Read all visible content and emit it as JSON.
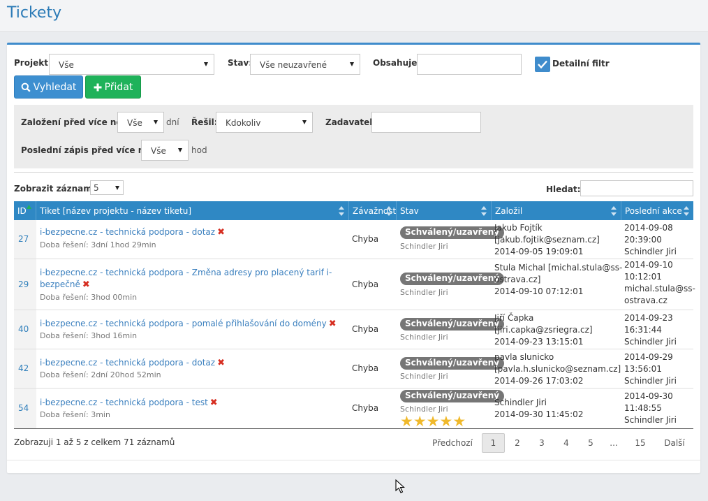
{
  "page": {
    "title": "Tickety"
  },
  "filters": {
    "project_label": "Projekt:",
    "project_value": "Vše",
    "status_label": "Stav:",
    "status_value": "Vše neuzavřené",
    "contains_label": "Obsahuje:",
    "contains_value": "",
    "detail_filter_label": "Detailní filtr",
    "detail_filter_checked": true,
    "search_button": "Vyhledat",
    "add_button": "Přidat"
  },
  "detail": {
    "created_label": "Založení před více než:",
    "created_value": "Vše",
    "created_unit": "dní",
    "solver_label": "Řešil:",
    "solver_value": "Kdokoliv",
    "requester_label": "Zadavatel:",
    "requester_value": "",
    "last_entry_label": "Poslední zápis před více než:",
    "last_entry_value": "Vše",
    "last_entry_unit": "hod"
  },
  "table_controls": {
    "show_label": "Zobrazit záznamů",
    "show_value": "5",
    "search_label": "Hledat:",
    "search_value": ""
  },
  "columns": {
    "id": "ID",
    "ticket": "Tiket [název projektu - název tiketu]",
    "severity": "Závažnost",
    "status": "Stav",
    "created_by": "Založil",
    "last_action": "Poslední akce"
  },
  "rows": [
    {
      "id": "27",
      "title": "i-bezpecne.cz - technická podpora - dotaz",
      "duration": "Doba řešení: 3dní 1hod 29min",
      "severity": "Chyba",
      "status": "Schválený/uzavřený",
      "solver": "Schindler Jiri",
      "created_by_1": "Jakub Fojtík",
      "created_by_2": "[jakub.fojtik@seznam.cz]",
      "created_at": "2014-09-05 19:09:01",
      "last_1": "2014-09-08",
      "last_2": "20:39:00",
      "last_3": "Schindler Jiri",
      "last_4": ""
    },
    {
      "id": "29",
      "title_1": "i-bezpecne.cz - technická podpora - Změna adresy pro placený tarif i-",
      "title_2": "bezpečně",
      "duration": "Doba řešení: 3hod 00min",
      "severity": "Chyba",
      "status": "Schválený/uzavřený",
      "solver": "Schindler Jiri",
      "created_by_1": "Stula Michal [michal.stula@ss-",
      "created_by_2": "ostrava.cz]",
      "created_at": "2014-09-10 07:12:01",
      "last_1": "2014-09-10",
      "last_2": "10:12:01",
      "last_3": "michal.stula@ss-",
      "last_4": "ostrava.cz"
    },
    {
      "id": "40",
      "title": "i-bezpecne.cz - technická podpora - pomalé přihlašování do domény",
      "duration": "Doba řešení: 3hod 16min",
      "severity": "Chyba",
      "status": "Schválený/uzavřený",
      "solver": "Schindler Jiri",
      "created_by_1": "Jiří Čapka",
      "created_by_2": "[jiri.capka@zsriegra.cz]",
      "created_at": "2014-09-23 13:15:01",
      "last_1": "2014-09-23",
      "last_2": "16:31:44",
      "last_3": "Schindler Jiri",
      "last_4": ""
    },
    {
      "id": "42",
      "title": "i-bezpecne.cz - technická podpora - dotaz",
      "duration": "Doba řešení: 2dní 20hod 52min",
      "severity": "Chyba",
      "status": "Schválený/uzavřený",
      "solver": "Schindler Jiri",
      "created_by_1": "pavla slunicko",
      "created_by_2": "[pavla.h.slunicko@seznam.cz]",
      "created_at": "2014-09-26 17:03:02",
      "last_1": "2014-09-29",
      "last_2": "13:56:01",
      "last_3": "Schindler Jiri",
      "last_4": ""
    },
    {
      "id": "54",
      "title": "i-bezpecne.cz - technická podpora - test",
      "duration": "Doba řešení: 3min",
      "severity": "Chyba",
      "status": "Schválený/uzavřený",
      "solver": "Schindler Jiri",
      "rating": 5,
      "created_by_1": "Schindler Jiri",
      "created_at": "2014-09-30 11:45:02",
      "last_1": "2014-09-30",
      "last_2": "11:48:55",
      "last_3": "Schindler Jiri",
      "last_4": ""
    }
  ],
  "footer": {
    "info": "Zobrazuji 1 až 5 z celkem 71 záznamů",
    "prev": "Předchozí",
    "pages": [
      "1",
      "2",
      "3",
      "4",
      "5",
      "...",
      "15"
    ],
    "active_page": "1",
    "next": "Další"
  },
  "colors": {
    "accent": "#3f8ccc",
    "header_bar": "#2f88c4",
    "link": "#3a7fbe",
    "green_button": "#1fb25a",
    "delete_icon": "#d62d20",
    "badge": "#767676",
    "star": "#f0b92b"
  }
}
